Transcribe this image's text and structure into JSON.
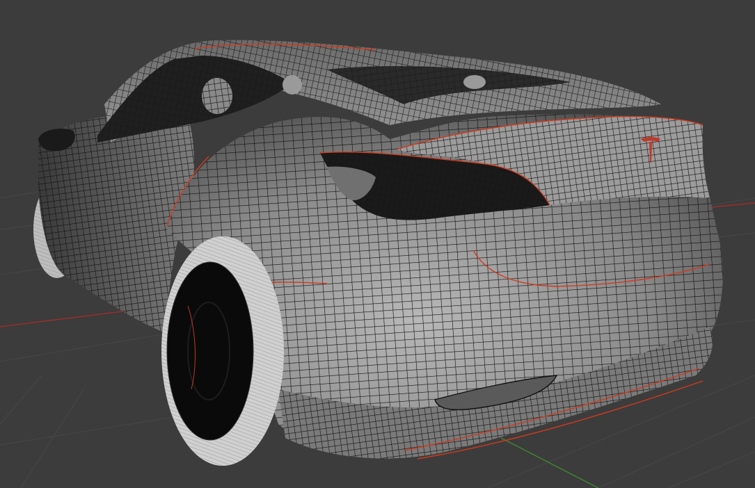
{
  "viewport": {
    "mode": "edit-mode-wireframe-overlay",
    "background_color": "#3c3c3c",
    "grid_color": "#4a4a4a",
    "x_axis_color": "#9c2d2d",
    "y_axis_color": "#3f8a2e",
    "seam_color": "#d23a1e",
    "wire_color": "#111111",
    "surface_color": "#8f8f8f",
    "tire_color": "#c9c9c9"
  },
  "model": {
    "object": "car-body-mesh",
    "view": "rear-three-quarter",
    "emblem_icon": "tesla-logo-icon"
  }
}
